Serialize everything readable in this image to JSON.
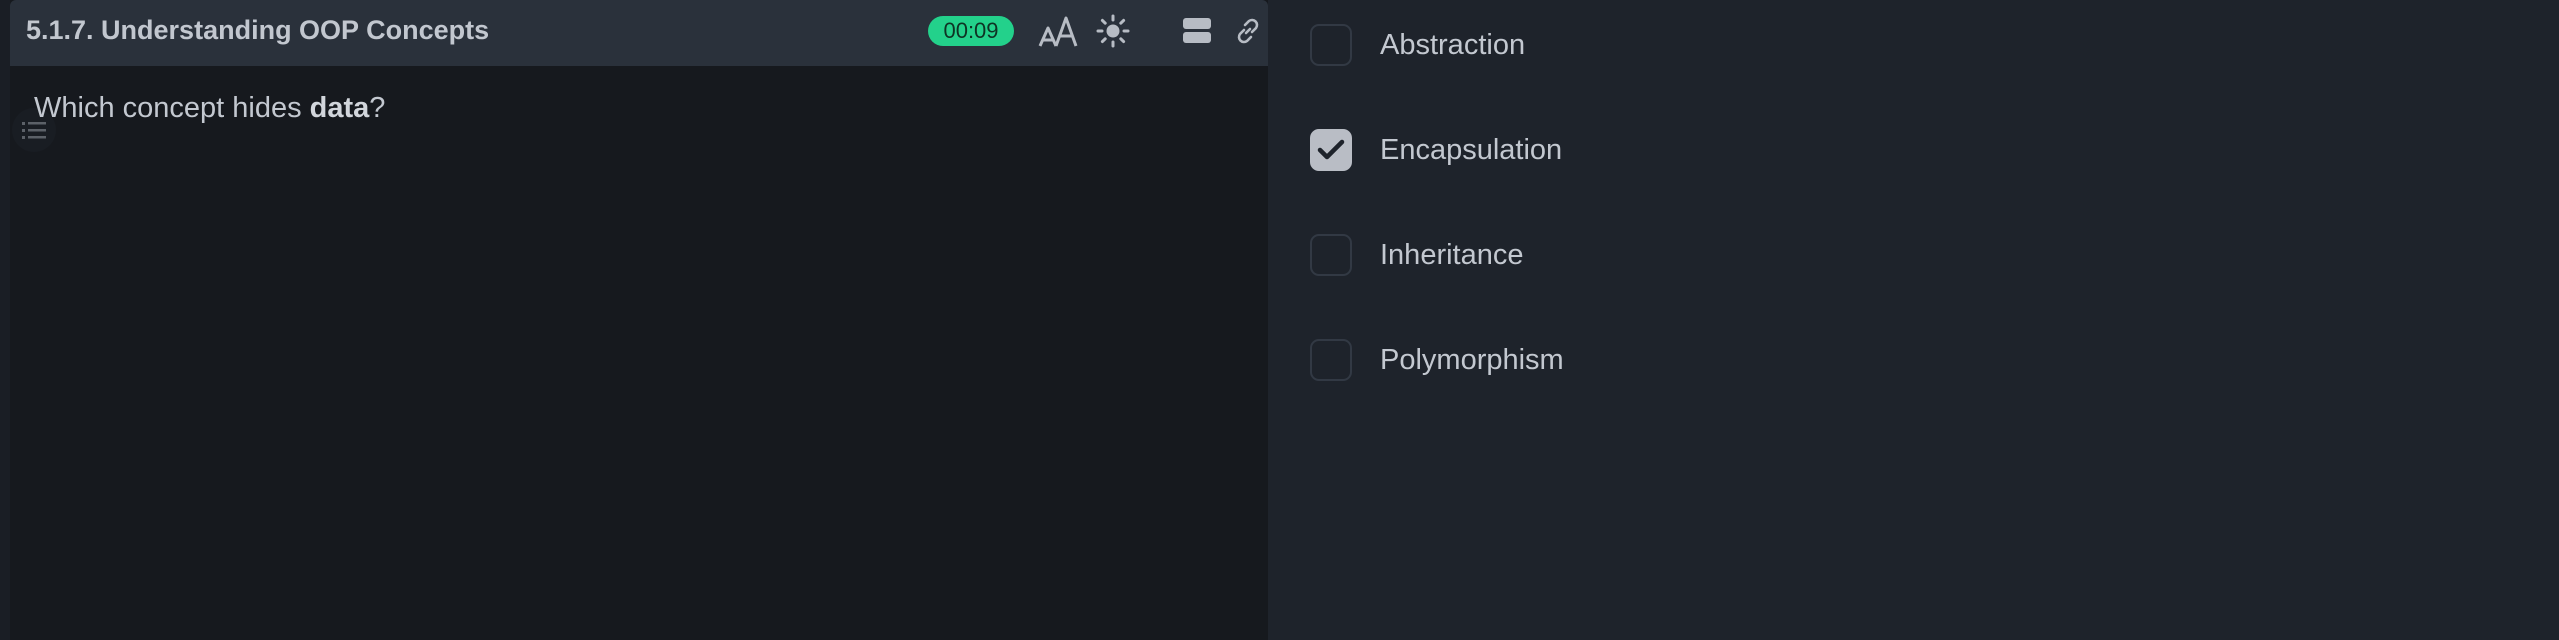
{
  "header": {
    "title": "5.1.7. Understanding OOP Concepts",
    "timer": "00:09",
    "icons": [
      "font-size-icon",
      "theme-icon",
      "layout-icon",
      "link-icon"
    ],
    "timer_color": "#23d18b"
  },
  "question": {
    "prefix": "Which concept hides ",
    "emphasis": "data",
    "suffix": "?"
  },
  "options": [
    {
      "label": "Abstraction",
      "checked": false
    },
    {
      "label": "Encapsulation",
      "checked": true
    },
    {
      "label": "Inheritance",
      "checked": false
    },
    {
      "label": "Polymorphism",
      "checked": false
    }
  ],
  "sidebar": {
    "toc_icon": "list-icon"
  }
}
